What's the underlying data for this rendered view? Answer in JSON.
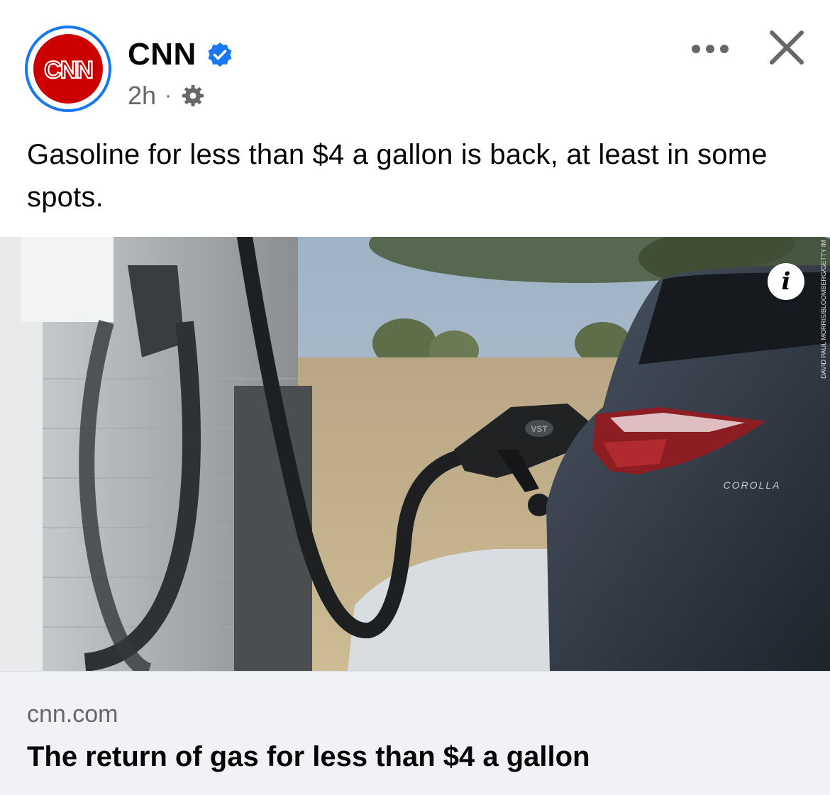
{
  "post": {
    "author": {
      "name": "CNN",
      "logo_text": "CNN",
      "verified": true,
      "timestamp": "2h",
      "separator": "·",
      "audience_icon": "gear-icon"
    },
    "actions": {
      "more_icon": "more-dots-icon",
      "close_icon": "close-icon"
    },
    "text": "Gasoline for less than $4 a gallon is back, at least in some spots.",
    "image": {
      "info_label": "i",
      "car_badge": "COROLLA",
      "nozzle_badge": "VST",
      "credit": "DAVID PAUL MORRIS/BLOOMBERG/GETTY IM"
    },
    "link": {
      "domain": "cnn.com",
      "title": "The return of gas for less than $4 a gallon"
    }
  },
  "colors": {
    "brand_red": "#cc0000",
    "verified_blue": "#1877f2",
    "meta_gray": "#65676b",
    "card_bg": "#f0f2f5"
  }
}
